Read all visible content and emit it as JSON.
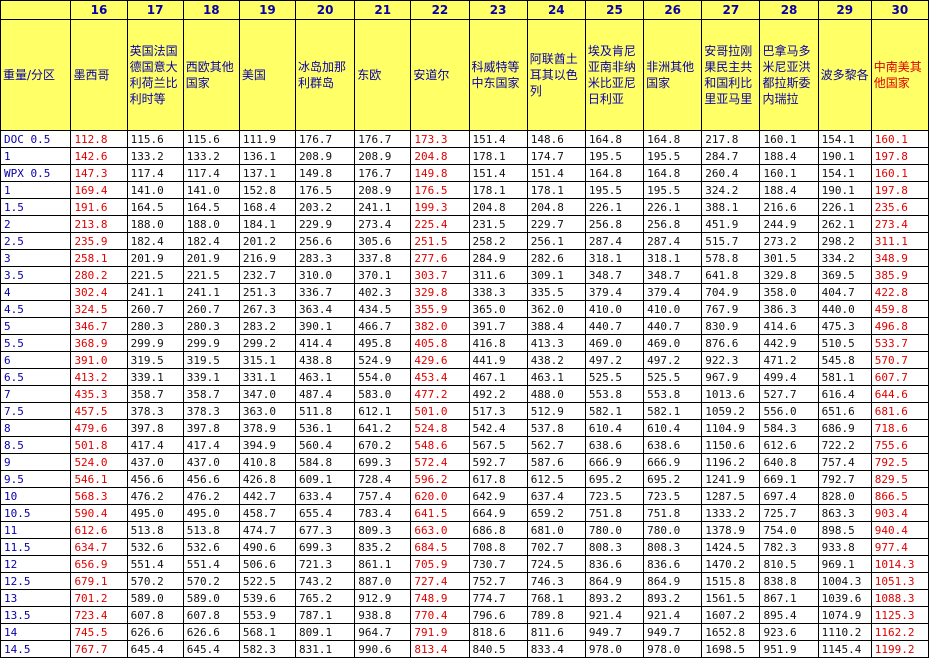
{
  "table": {
    "corner_label": "重量/分区",
    "zones": [
      "16",
      "17",
      "18",
      "19",
      "20",
      "21",
      "22",
      "23",
      "24",
      "25",
      "26",
      "27",
      "28",
      "29",
      "30"
    ],
    "zone_names": [
      "墨西哥",
      "英国法国德国意大利荷兰比利时等",
      "西欧其他国家",
      "美国",
      "冰岛加那利群岛",
      "东欧",
      "安道尔",
      "科威特等中东国家",
      "阿联酋土耳其以色列",
      "埃及肯尼亚南非纳米比亚尼日利亚",
      "非洲其他国家",
      "安哥拉刚果民主共和国利比里亚马里",
      "巴拿马多米尼亚洪都拉斯委内瑞拉",
      "波多黎各",
      "中南美其他国家"
    ],
    "red_columns": [
      0,
      6,
      14
    ],
    "red_header": [
      14
    ],
    "rows": [
      {
        "w": "DOC 0.5",
        "v": [
          "112.8",
          "115.6",
          "115.6",
          "111.9",
          "176.7",
          "176.7",
          "173.3",
          "151.4",
          "148.6",
          "164.8",
          "164.8",
          "217.8",
          "160.1",
          "154.1",
          "160.1"
        ]
      },
      {
        "w": "1",
        "v": [
          "142.6",
          "133.2",
          "133.2",
          "136.1",
          "208.9",
          "208.9",
          "204.8",
          "178.1",
          "174.7",
          "195.5",
          "195.5",
          "284.7",
          "188.4",
          "190.1",
          "197.8"
        ]
      },
      {
        "w": "WPX 0.5",
        "v": [
          "147.3",
          "117.4",
          "117.4",
          "137.1",
          "149.8",
          "176.7",
          "149.8",
          "151.4",
          "151.4",
          "164.8",
          "164.8",
          "260.4",
          "160.1",
          "154.1",
          "160.1"
        ]
      },
      {
        "w": "1",
        "v": [
          "169.4",
          "141.0",
          "141.0",
          "152.8",
          "176.5",
          "208.9",
          "176.5",
          "178.1",
          "178.1",
          "195.5",
          "195.5",
          "324.2",
          "188.4",
          "190.1",
          "197.8"
        ]
      },
      {
        "w": "1.5",
        "v": [
          "191.6",
          "164.5",
          "164.5",
          "168.4",
          "203.2",
          "241.1",
          "199.3",
          "204.8",
          "204.8",
          "226.1",
          "226.1",
          "388.1",
          "216.6",
          "226.1",
          "235.6"
        ]
      },
      {
        "w": "2",
        "v": [
          "213.8",
          "188.0",
          "188.0",
          "184.1",
          "229.9",
          "273.4",
          "225.4",
          "231.5",
          "229.7",
          "256.8",
          "256.8",
          "451.9",
          "244.9",
          "262.1",
          "273.4"
        ]
      },
      {
        "w": "2.5",
        "v": [
          "235.9",
          "182.4",
          "182.4",
          "201.2",
          "256.6",
          "305.6",
          "251.5",
          "258.2",
          "256.1",
          "287.4",
          "287.4",
          "515.7",
          "273.2",
          "298.2",
          "311.1"
        ]
      },
      {
        "w": "3",
        "v": [
          "258.1",
          "201.9",
          "201.9",
          "216.9",
          "283.3",
          "337.8",
          "277.6",
          "284.9",
          "282.6",
          "318.1",
          "318.1",
          "578.8",
          "301.5",
          "334.2",
          "348.9"
        ]
      },
      {
        "w": "3.5",
        "v": [
          "280.2",
          "221.5",
          "221.5",
          "232.7",
          "310.0",
          "370.1",
          "303.7",
          "311.6",
          "309.1",
          "348.7",
          "348.7",
          "641.8",
          "329.8",
          "369.5",
          "385.9"
        ]
      },
      {
        "w": "4",
        "v": [
          "302.4",
          "241.1",
          "241.1",
          "251.3",
          "336.7",
          "402.3",
          "329.8",
          "338.3",
          "335.5",
          "379.4",
          "379.4",
          "704.9",
          "358.0",
          "404.7",
          "422.8"
        ]
      },
      {
        "w": "4.5",
        "v": [
          "324.5",
          "260.7",
          "260.7",
          "267.3",
          "363.4",
          "434.5",
          "355.9",
          "365.0",
          "362.0",
          "410.0",
          "410.0",
          "767.9",
          "386.3",
          "440.0",
          "459.8"
        ]
      },
      {
        "w": "5",
        "v": [
          "346.7",
          "280.3",
          "280.3",
          "283.2",
          "390.1",
          "466.7",
          "382.0",
          "391.7",
          "388.4",
          "440.7",
          "440.7",
          "830.9",
          "414.6",
          "475.3",
          "496.8"
        ]
      },
      {
        "w": "5.5",
        "v": [
          "368.9",
          "299.9",
          "299.9",
          "299.2",
          "414.4",
          "495.8",
          "405.8",
          "416.8",
          "413.3",
          "469.0",
          "469.0",
          "876.6",
          "442.9",
          "510.5",
          "533.7"
        ]
      },
      {
        "w": "6",
        "v": [
          "391.0",
          "319.5",
          "319.5",
          "315.1",
          "438.8",
          "524.9",
          "429.6",
          "441.9",
          "438.2",
          "497.2",
          "497.2",
          "922.3",
          "471.2",
          "545.8",
          "570.7"
        ]
      },
      {
        "w": "6.5",
        "v": [
          "413.2",
          "339.1",
          "339.1",
          "331.1",
          "463.1",
          "554.0",
          "453.4",
          "467.1",
          "463.1",
          "525.5",
          "525.5",
          "967.9",
          "499.4",
          "581.1",
          "607.7"
        ]
      },
      {
        "w": "7",
        "v": [
          "435.3",
          "358.7",
          "358.7",
          "347.0",
          "487.4",
          "583.0",
          "477.2",
          "492.2",
          "488.0",
          "553.8",
          "553.8",
          "1013.6",
          "527.7",
          "616.4",
          "644.6"
        ]
      },
      {
        "w": "7.5",
        "v": [
          "457.5",
          "378.3",
          "378.3",
          "363.0",
          "511.8",
          "612.1",
          "501.0",
          "517.3",
          "512.9",
          "582.1",
          "582.1",
          "1059.2",
          "556.0",
          "651.6",
          "681.6"
        ]
      },
      {
        "w": "8",
        "v": [
          "479.6",
          "397.8",
          "397.8",
          "378.9",
          "536.1",
          "641.2",
          "524.8",
          "542.4",
          "537.8",
          "610.4",
          "610.4",
          "1104.9",
          "584.3",
          "686.9",
          "718.6"
        ]
      },
      {
        "w": "8.5",
        "v": [
          "501.8",
          "417.4",
          "417.4",
          "394.9",
          "560.4",
          "670.2",
          "548.6",
          "567.5",
          "562.7",
          "638.6",
          "638.6",
          "1150.6",
          "612.6",
          "722.2",
          "755.6"
        ]
      },
      {
        "w": "9",
        "v": [
          "524.0",
          "437.0",
          "437.0",
          "410.8",
          "584.8",
          "699.3",
          "572.4",
          "592.7",
          "587.6",
          "666.9",
          "666.9",
          "1196.2",
          "640.8",
          "757.4",
          "792.5"
        ]
      },
      {
        "w": "9.5",
        "v": [
          "546.1",
          "456.6",
          "456.6",
          "426.8",
          "609.1",
          "728.4",
          "596.2",
          "617.8",
          "612.5",
          "695.2",
          "695.2",
          "1241.9",
          "669.1",
          "792.7",
          "829.5"
        ]
      },
      {
        "w": "10",
        "v": [
          "568.3",
          "476.2",
          "476.2",
          "442.7",
          "633.4",
          "757.4",
          "620.0",
          "642.9",
          "637.4",
          "723.5",
          "723.5",
          "1287.5",
          "697.4",
          "828.0",
          "866.5"
        ]
      },
      {
        "w": "10.5",
        "v": [
          "590.4",
          "495.0",
          "495.0",
          "458.7",
          "655.4",
          "783.4",
          "641.5",
          "664.9",
          "659.2",
          "751.8",
          "751.8",
          "1333.2",
          "725.7",
          "863.3",
          "903.4"
        ]
      },
      {
        "w": "11",
        "v": [
          "612.6",
          "513.8",
          "513.8",
          "474.7",
          "677.3",
          "809.3",
          "663.0",
          "686.8",
          "681.0",
          "780.0",
          "780.0",
          "1378.9",
          "754.0",
          "898.5",
          "940.4"
        ]
      },
      {
        "w": "11.5",
        "v": [
          "634.7",
          "532.6",
          "532.6",
          "490.6",
          "699.3",
          "835.2",
          "684.5",
          "708.8",
          "702.7",
          "808.3",
          "808.3",
          "1424.5",
          "782.3",
          "933.8",
          "977.4"
        ]
      },
      {
        "w": "12",
        "v": [
          "656.9",
          "551.4",
          "551.4",
          "506.6",
          "721.3",
          "861.1",
          "705.9",
          "730.7",
          "724.5",
          "836.6",
          "836.6",
          "1470.2",
          "810.5",
          "969.1",
          "1014.3"
        ]
      },
      {
        "w": "12.5",
        "v": [
          "679.1",
          "570.2",
          "570.2",
          "522.5",
          "743.2",
          "887.0",
          "727.4",
          "752.7",
          "746.3",
          "864.9",
          "864.9",
          "1515.8",
          "838.8",
          "1004.3",
          "1051.3"
        ]
      },
      {
        "w": "13",
        "v": [
          "701.2",
          "589.0",
          "589.0",
          "539.6",
          "765.2",
          "912.9",
          "748.9",
          "774.7",
          "768.1",
          "893.2",
          "893.2",
          "1561.5",
          "867.1",
          "1039.6",
          "1088.3"
        ]
      },
      {
        "w": "13.5",
        "v": [
          "723.4",
          "607.8",
          "607.8",
          "553.9",
          "787.1",
          "938.8",
          "770.4",
          "796.6",
          "789.8",
          "921.4",
          "921.4",
          "1607.2",
          "895.4",
          "1074.9",
          "1125.3"
        ]
      },
      {
        "w": "14",
        "v": [
          "745.5",
          "626.6",
          "626.6",
          "568.1",
          "809.1",
          "964.7",
          "791.9",
          "818.6",
          "811.6",
          "949.7",
          "949.7",
          "1652.8",
          "923.6",
          "1110.2",
          "1162.2"
        ]
      },
      {
        "w": "14.5",
        "v": [
          "767.7",
          "645.4",
          "645.4",
          "582.3",
          "831.1",
          "990.6",
          "813.4",
          "840.5",
          "833.4",
          "978.0",
          "978.0",
          "1698.5",
          "951.9",
          "1145.4",
          "1199.2"
        ]
      }
    ]
  }
}
